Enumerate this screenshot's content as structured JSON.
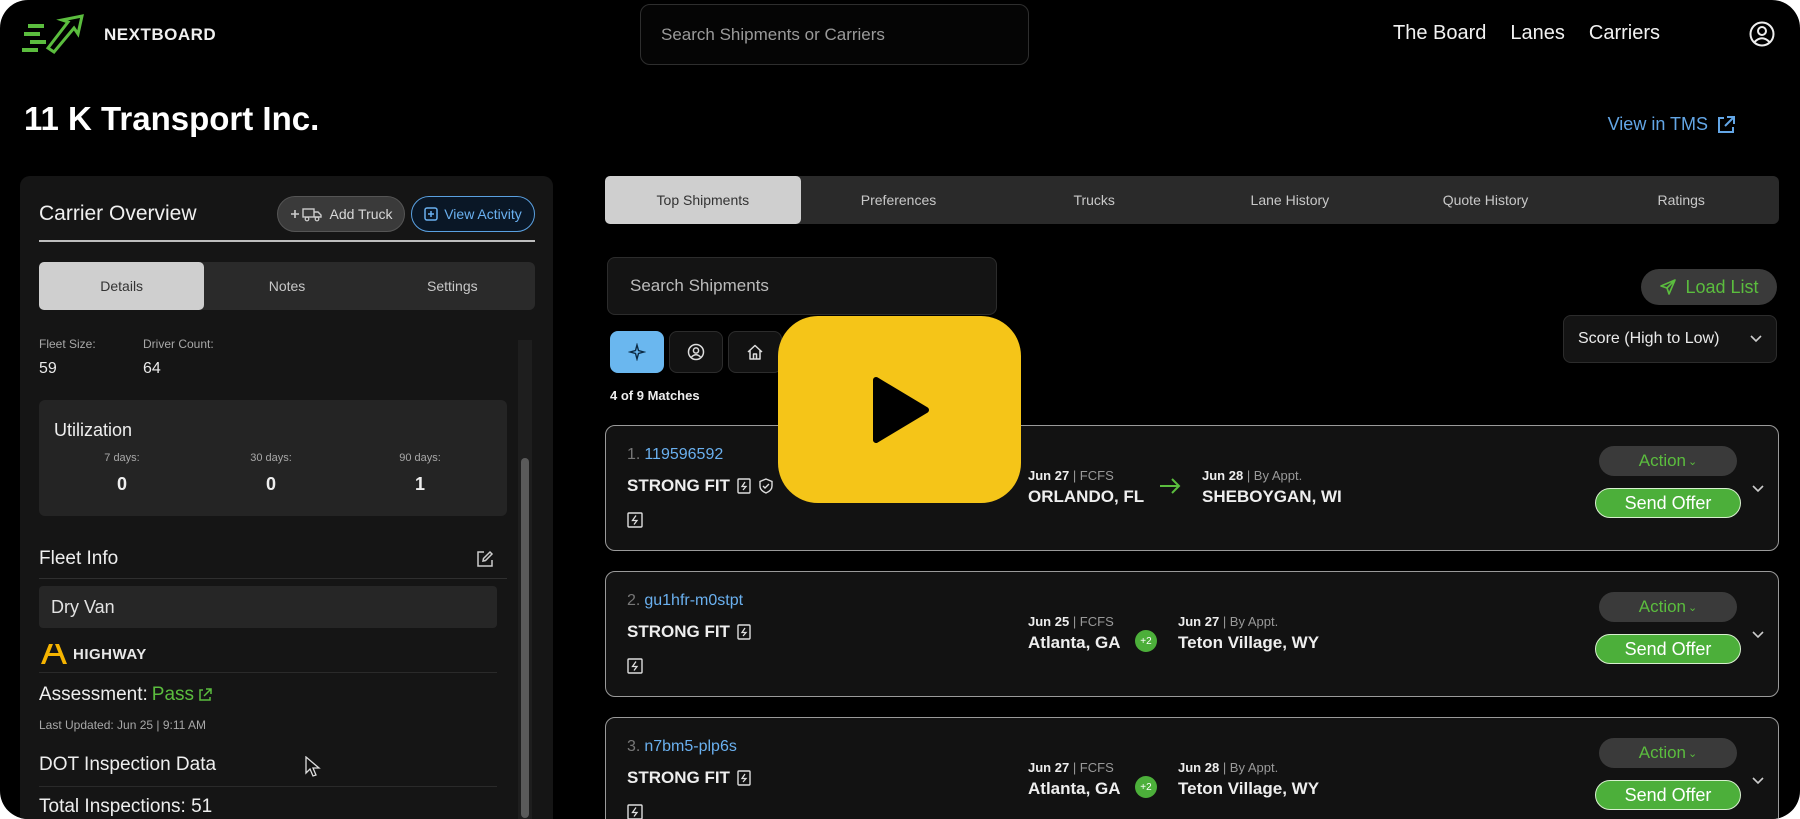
{
  "header": {
    "brand": "NEXTBOARD",
    "search_placeholder": "Search Shipments or Carriers",
    "nav": [
      "The Board",
      "Lanes",
      "Carriers"
    ]
  },
  "page": {
    "title": "11 K Transport Inc.",
    "view_tms": "View in TMS"
  },
  "overview": {
    "title": "Carrier Overview",
    "add_truck": "Add Truck",
    "view_activity": "View Activity",
    "tabs": [
      "Details",
      "Notes",
      "Settings"
    ],
    "fleet_size_label": "Fleet Size:",
    "fleet_size": "59",
    "driver_count_label": "Driver Count:",
    "driver_count": "64",
    "utilization": {
      "title": "Utilization",
      "cols": [
        {
          "label": "7 days:",
          "value": "0"
        },
        {
          "label": "30 days:",
          "value": "0"
        },
        {
          "label": "90 days:",
          "value": "1"
        }
      ]
    },
    "fleet_info_title": "Fleet Info",
    "equipment": "Dry Van",
    "highway": "HIGHWAY",
    "assessment_label": "Assessment:",
    "assessment_value": "Pass",
    "last_updated": "Last Updated: Jun 25 | 9:11 AM",
    "dot_title": "DOT Inspection Data",
    "total_inspections": "Total Inspections: 51"
  },
  "main": {
    "tabs": [
      "Top Shipments",
      "Preferences",
      "Trucks",
      "Lane History",
      "Quote History",
      "Ratings"
    ],
    "search_placeholder": "Search Shipments",
    "load_list": "Load List",
    "sort": "Score (High to Low)",
    "match_count": "4 of 9 Matches",
    "shipments": [
      {
        "num": "1.",
        "id": "119596592",
        "carrier": "STRONG FIT",
        "pickup_date": "Jun 27",
        "pickup_type": "| FCFS",
        "pickup_city": "ORLANDO, FL",
        "delivery_date": "Jun 28",
        "delivery_type": "| By Appt.",
        "delivery_city": "SHEBOYGAN, WI",
        "stops": "",
        "action": "Action",
        "offer": "Send Offer"
      },
      {
        "num": "2.",
        "id": "gu1hfr-m0stpt",
        "carrier": "STRONG FIT",
        "pickup_date": "Jun 25",
        "pickup_type": "| FCFS",
        "pickup_city": "Atlanta, GA",
        "delivery_date": "Jun 27",
        "delivery_type": "| By Appt.",
        "delivery_city": "Teton Village, WY",
        "stops": "+2",
        "action": "Action",
        "offer": "Send Offer"
      },
      {
        "num": "3.",
        "id": "n7bm5-plp6s",
        "carrier": "STRONG FIT",
        "pickup_date": "Jun 27",
        "pickup_type": "| FCFS",
        "pickup_city": "Atlanta, GA",
        "delivery_date": "Jun 28",
        "delivery_type": "| By Appt.",
        "delivery_city": "Teton Village, WY",
        "stops": "+2",
        "action": "Action",
        "offer": "Send Offer"
      }
    ]
  },
  "colors": {
    "accent_blue": "#6ab0ef",
    "accent_green": "#5bbd3e",
    "play_yellow": "#f5c518"
  }
}
